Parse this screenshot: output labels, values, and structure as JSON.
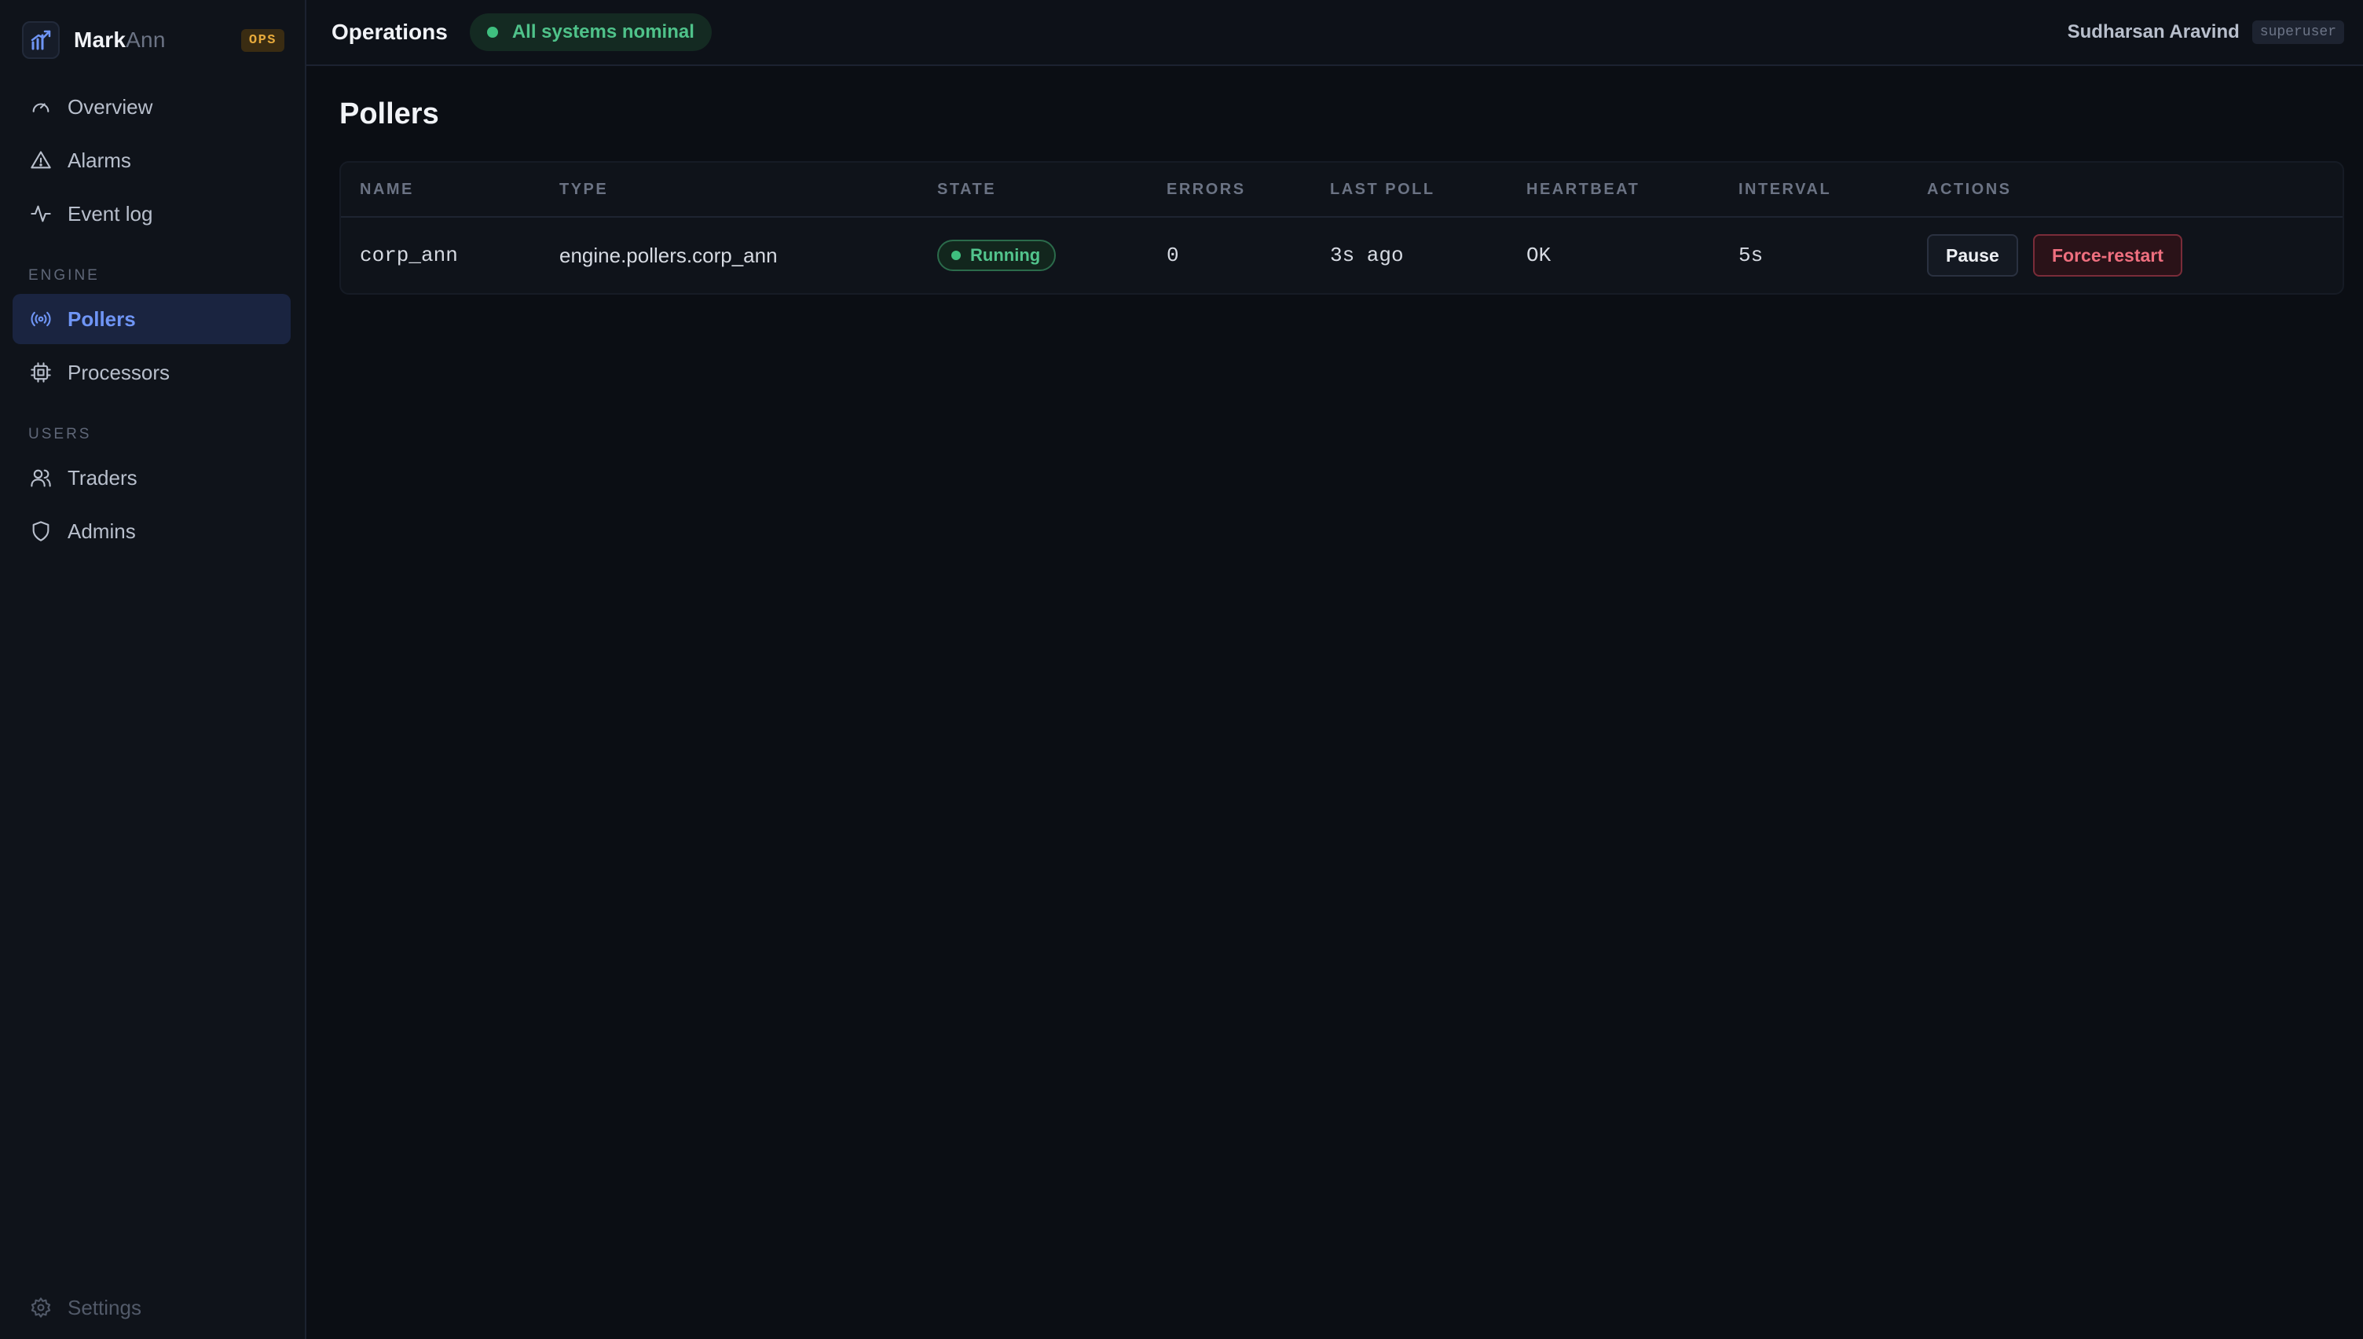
{
  "brand": {
    "name_primary": "Mark",
    "name_secondary": "Ann",
    "badge": "OPS",
    "logo_icon": "chart-trend-icon"
  },
  "nav": {
    "items_top": [
      {
        "label": "Overview",
        "icon": "gauge-icon"
      },
      {
        "label": "Alarms",
        "icon": "warning-triangle-icon"
      },
      {
        "label": "Event log",
        "icon": "activity-pulse-icon"
      }
    ],
    "section_engine": "ENGINE",
    "items_engine": [
      {
        "label": "Pollers",
        "icon": "broadcast-signal-icon",
        "active": true
      },
      {
        "label": "Processors",
        "icon": "cpu-chip-icon"
      }
    ],
    "section_users": "USERS",
    "items_users": [
      {
        "label": "Traders",
        "icon": "users-icon"
      },
      {
        "label": "Admins",
        "icon": "shield-icon"
      }
    ],
    "footer_label": "Settings",
    "footer_icon": "gear-icon"
  },
  "topbar": {
    "title": "Operations",
    "status": "All systems nominal",
    "user_name": "Sudharsan Aravind",
    "user_role": "superuser"
  },
  "page": {
    "title": "Pollers"
  },
  "table": {
    "columns": [
      "NAME",
      "TYPE",
      "STATE",
      "ERRORS",
      "LAST POLL",
      "HEARTBEAT",
      "INTERVAL",
      "ACTIONS"
    ],
    "rows": [
      {
        "name": "corp_ann",
        "type": "engine.pollers.corp_ann",
        "state": "Running",
        "errors": "0",
        "last_poll": "3s ago",
        "heartbeat": "OK",
        "interval": "5s",
        "action_primary": "Pause",
        "action_secondary": "Force-restart"
      }
    ]
  },
  "colors": {
    "accent": "#6f95f5",
    "success": "#3fbf7f",
    "danger": "#ef6f7f",
    "warning": "#e5a93b",
    "background": "#0b0e14"
  }
}
